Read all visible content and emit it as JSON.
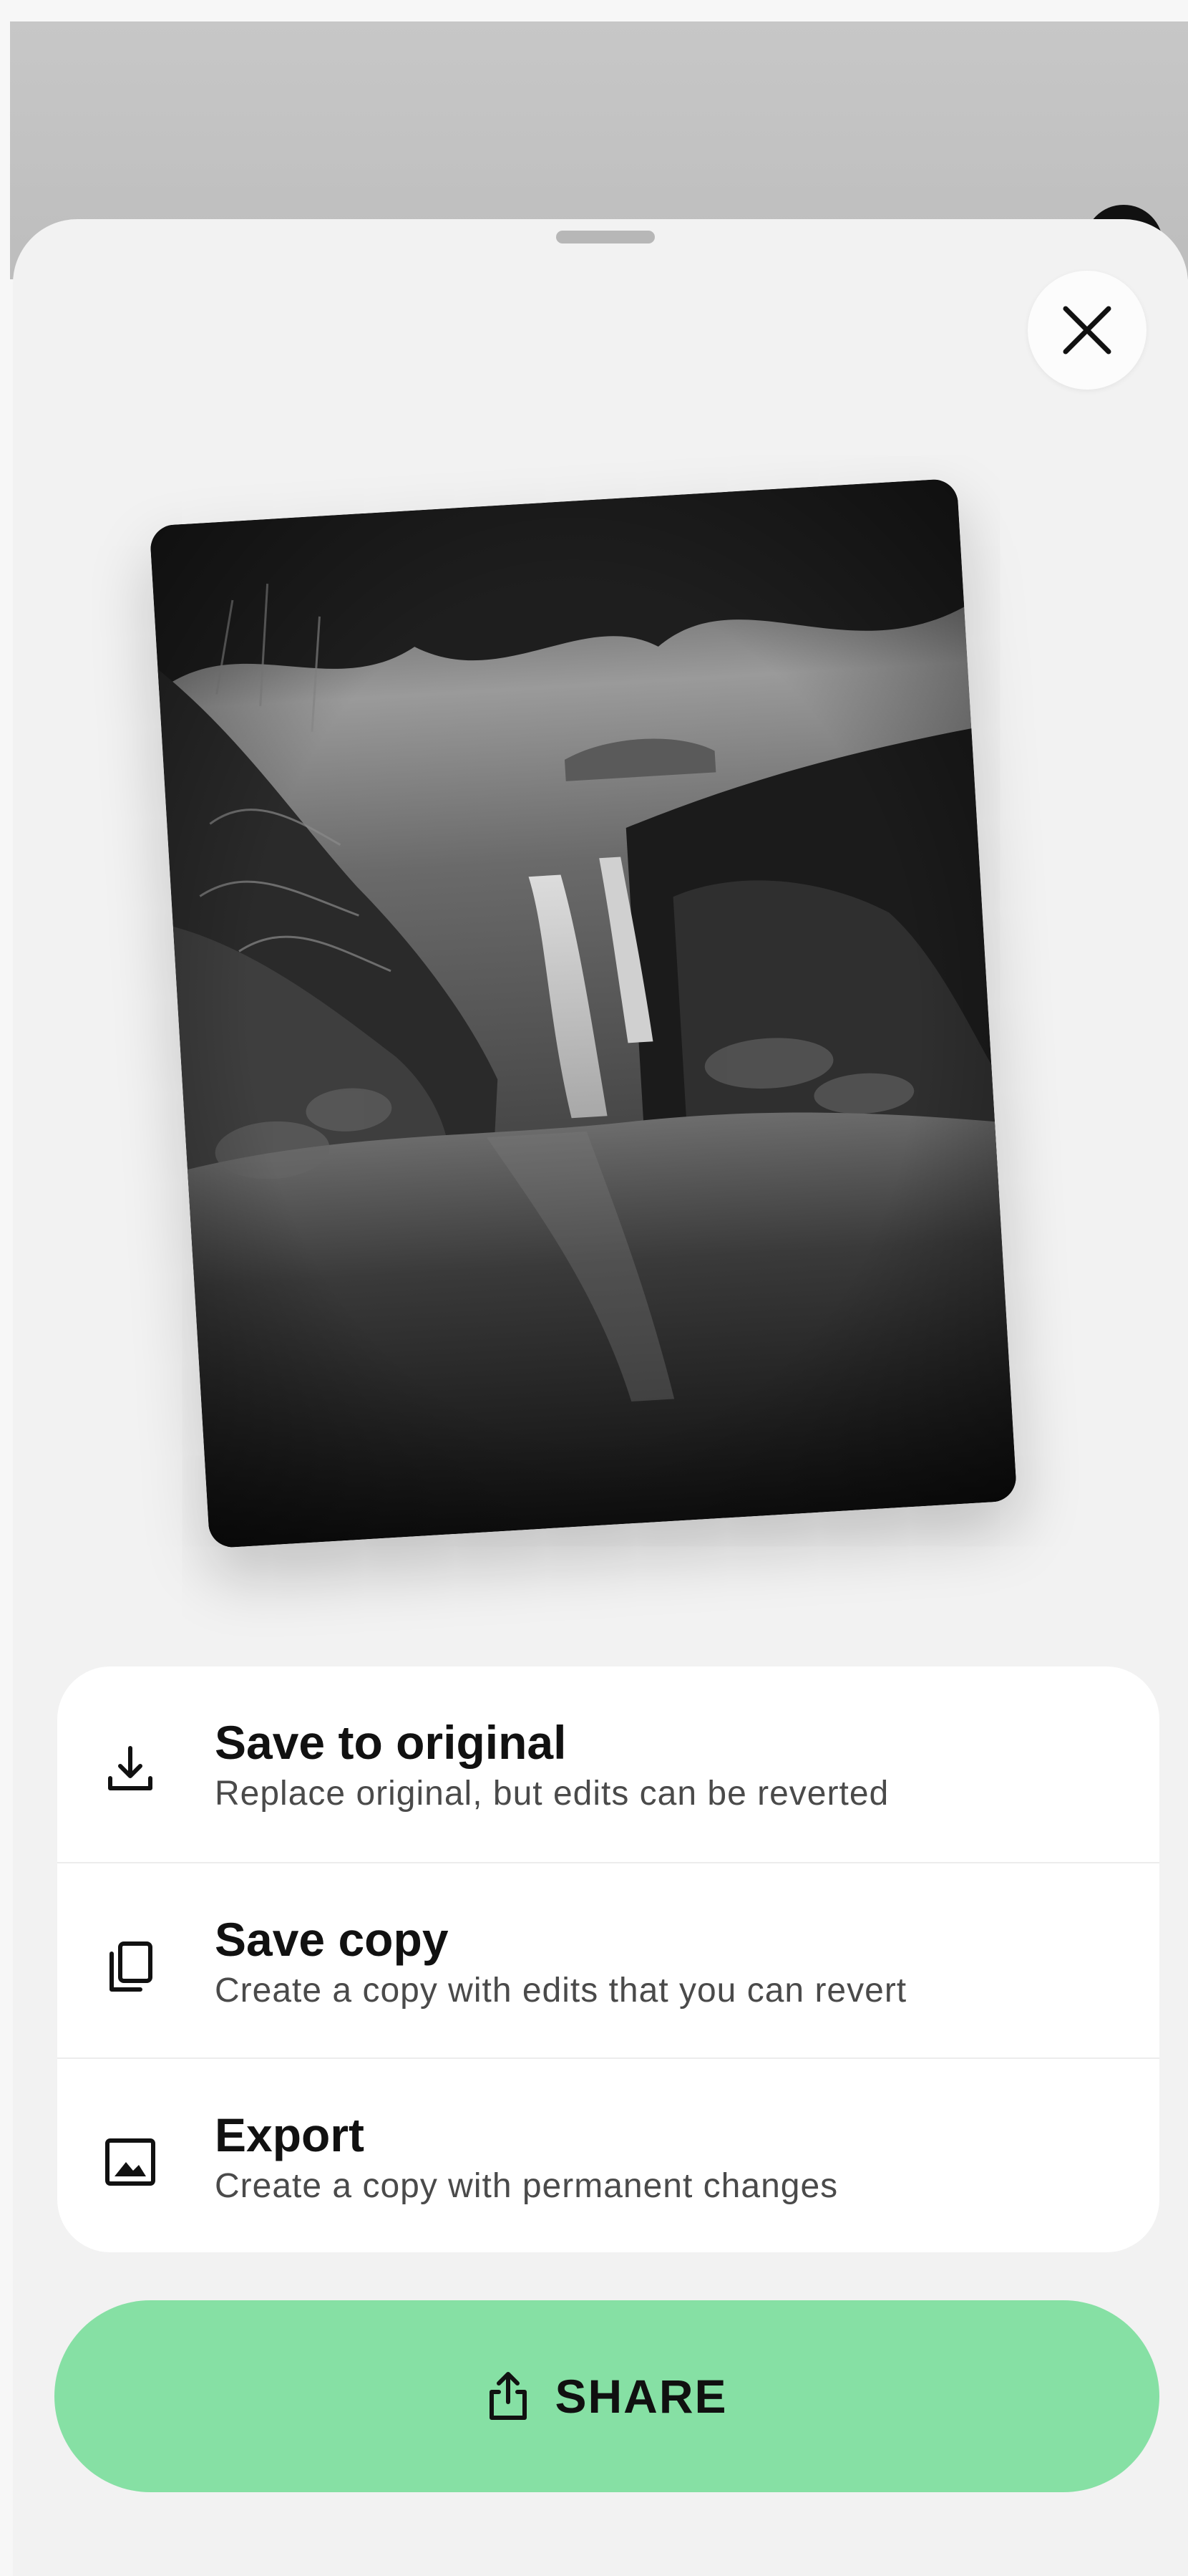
{
  "sheet": {
    "close_icon": "close-icon"
  },
  "preview": {
    "image": "black-and-white waterfall photo"
  },
  "options": [
    {
      "icon": "download-icon",
      "title": "Save to original",
      "subtitle": "Replace original, but edits can be reverted"
    },
    {
      "icon": "copy-icon",
      "title": "Save copy",
      "subtitle": "Create a copy with edits that you can revert"
    },
    {
      "icon": "image-icon",
      "title": "Export",
      "subtitle": "Create a copy with permanent changes"
    }
  ],
  "share": {
    "icon": "share-icon",
    "label": "SHARE"
  },
  "colors": {
    "accent": "#86e0a4",
    "sheet_bg": "#f2f2f2",
    "card_bg": "#ffffff"
  }
}
